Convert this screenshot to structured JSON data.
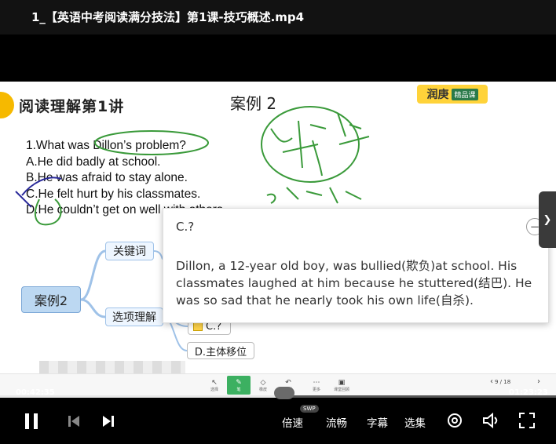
{
  "window": {
    "title": "1_【英语中考阅读满分技法】第1课-技巧概述.mp4"
  },
  "slide": {
    "lesson_title": "阅读理解第1讲",
    "case_title": "案例 2",
    "brand": {
      "name": "润庚",
      "tag": "精品课"
    },
    "question": {
      "stem": "1.What was Dillon’s problem?",
      "options": [
        "A.He did badly at school.",
        "B.He was afraid to stay alone.",
        "C.He felt hurt by his classmates.",
        "D.He couldn’t get on well with others."
      ]
    },
    "mindmap": {
      "center": "案例2",
      "keywords": "关键词",
      "option_analysis": "选项理解",
      "option_c": "C.?",
      "option_d": "D.主体移位"
    },
    "popup": {
      "title": "C.?",
      "body": "Dillon, a 12-year old boy, was bullied(欺负)at school. His classmates laughed at him because he stuttered(结巴). He was so sad that he nearly took his own life(自杀)."
    },
    "toolbar": {
      "tools": [
        {
          "icon": "cursor-icon",
          "label": "选择"
        },
        {
          "icon": "pen-icon",
          "label": "笔"
        },
        {
          "icon": "eraser-icon",
          "label": "橡皮"
        },
        {
          "icon": "undo-icon",
          "label": "撤销"
        },
        {
          "icon": "more-icon",
          "label": "更多"
        },
        {
          "icon": "classroom-icon",
          "label": "课堂回顾"
        }
      ],
      "page": "9 / 18"
    }
  },
  "player": {
    "elapsed": "00:42:35",
    "total": "01:23:23",
    "progress": 0.511,
    "speed_label": "倍速",
    "speed_badge": "SWP",
    "quality_label": "流畅",
    "subtitle_label": "字幕",
    "episodes_label": "选集"
  },
  "colors": {
    "brand": "#ffd33a",
    "mindmap_center": "#bcd8f2",
    "active_tool": "#3cb061"
  }
}
